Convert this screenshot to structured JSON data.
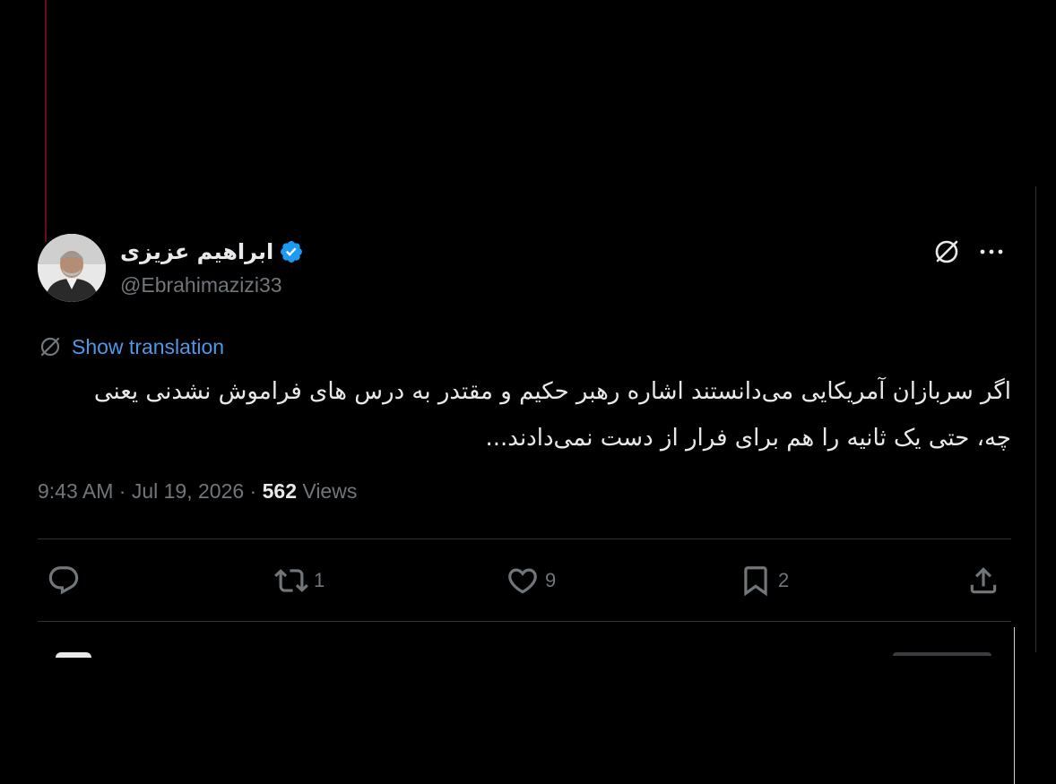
{
  "author": {
    "display_name": "ابراهیم عزیزی",
    "handle": "@Ebrahimazizi33",
    "verified": true,
    "avatar_icon": "profile-photo"
  },
  "translate": {
    "label": "Show translation",
    "icon": "translate-globe-icon"
  },
  "tweet": {
    "text": "اگر سربازان آمریکایی می‌دانستند اشاره رهبر حکیم و مقتدر به درس های فراموش نشدنی یعنی چه، حتی یک ثانیه را هم برای فرار از دست نمی‌دادند..."
  },
  "meta": {
    "time": "9:43 AM",
    "separator": " · ",
    "date": "Jul 19, 2026",
    "views_count": "562",
    "views_label": "Views"
  },
  "actions": {
    "reply_count": "",
    "retweet_count": "1",
    "like_count": "9",
    "bookmark_count": "2"
  },
  "colors": {
    "background": "#000000",
    "text": "#e7e9ea",
    "muted": "#71767b",
    "link": "#4d99e8",
    "verified": "#1d9bf0",
    "divider": "#2f3336"
  }
}
